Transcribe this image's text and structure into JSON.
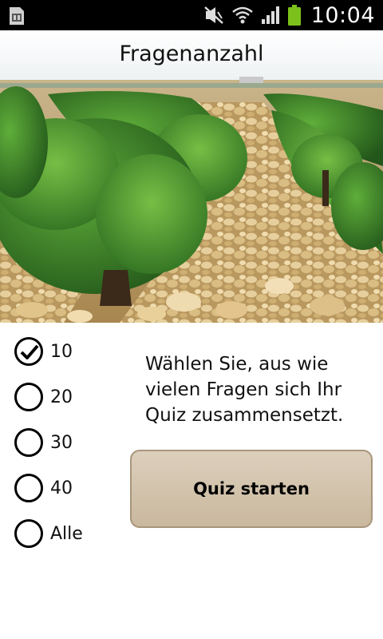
{
  "status_bar": {
    "time": "10:04",
    "icons": [
      "sim-card-icon",
      "mute-icon",
      "wifi-icon",
      "signal-icon",
      "battery-icon"
    ],
    "battery_color": "#7cc11b"
  },
  "header": {
    "title": "Fragenanzahl"
  },
  "question_count": {
    "options": [
      {
        "label": "10",
        "selected": true
      },
      {
        "label": "20",
        "selected": false
      },
      {
        "label": "30",
        "selected": false
      },
      {
        "label": "40",
        "selected": false
      },
      {
        "label": "Alle",
        "selected": false
      }
    ]
  },
  "instructions": {
    "text": "Wählen Sie, aus wie vielen Fragen sich Ihr Quiz zusammensetzt."
  },
  "start_button": {
    "label": "Quiz starten",
    "color": "#d2c3ab"
  }
}
